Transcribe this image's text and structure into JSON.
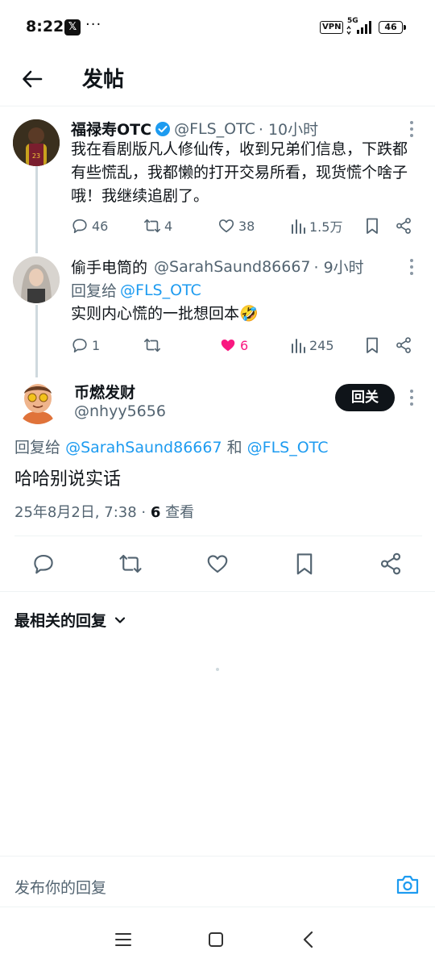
{
  "status_bar": {
    "time": "8:22",
    "app_badge": "𝕏",
    "dots": "···",
    "vpn": "VPN",
    "network": "5G",
    "battery": "46"
  },
  "header": {
    "title": "发帖"
  },
  "thread": [
    {
      "name": "福禄寿OTC",
      "verified": true,
      "handle": "@FLS_OTC",
      "time": "· 10小时",
      "text": "我在看剧版凡人修仙传，收到兄弟们信息，下跌都有些慌乱，我都懒的打开交易所看，现货慌个啥子哦！我继续追剧了。",
      "replies": "46",
      "reposts": "4",
      "likes": "38",
      "views": "1.5万"
    },
    {
      "name": "偷手电筒的",
      "handle": "@SarahSaund86667",
      "time": "· 9小时",
      "reply_to_prefix": "回复给",
      "reply_to": "@FLS_OTC",
      "text": "实则内心慌的一批想回本🤣",
      "replies": "1",
      "reposts": "",
      "likes": "6",
      "views": "245"
    }
  ],
  "focus": {
    "name": "币燃发财",
    "handle": "@nhyy5656",
    "follow_label": "回关",
    "reply_to_prefix": "回复给",
    "reply_to_1": "@SarahSaund86667",
    "reply_to_and": "和",
    "reply_to_2": "@FLS_OTC",
    "text": "哈哈别说实话",
    "date": "25年8月2日, 7:38 ·",
    "views_count": "6",
    "views_label": "查看"
  },
  "replies_sort": {
    "label": "最相关的回复"
  },
  "compose": {
    "placeholder": "发布你的回复"
  },
  "colors": {
    "accent": "#1d9bf0",
    "like": "#f91880",
    "text": "#0f1419",
    "muted": "#536471"
  }
}
